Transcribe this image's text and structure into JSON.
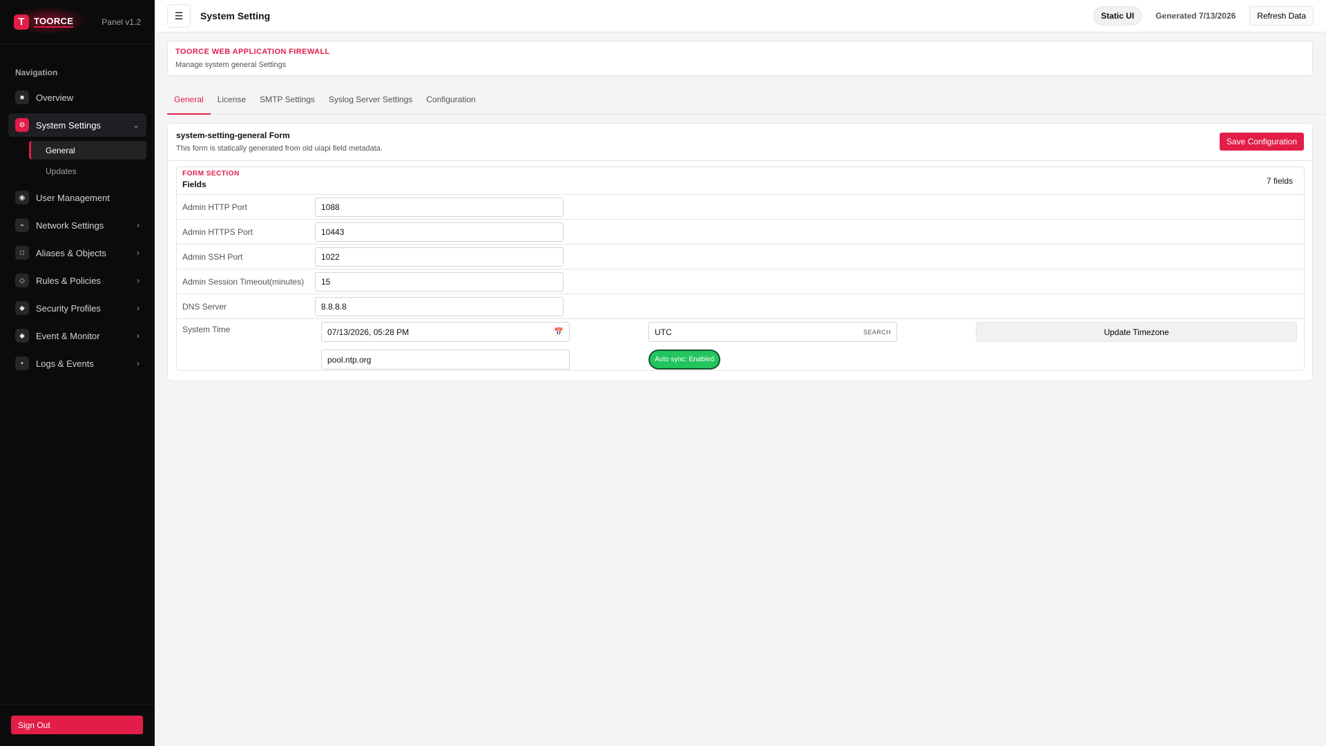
{
  "brand": {
    "logo_letter": "T",
    "name": "TOORCE",
    "version": "Panel v1.2"
  },
  "sidebar": {
    "nav_title": "Navigation",
    "items": [
      {
        "label": "Overview",
        "icon": "grid-icon",
        "glyph": "■"
      },
      {
        "label": "System Settings",
        "icon": "gear-icon",
        "glyph": "⚙",
        "chevron": "⌄"
      },
      {
        "label": "User Management",
        "icon": "user-icon",
        "glyph": "◉"
      },
      {
        "label": "Network Settings",
        "icon": "network-icon",
        "glyph": "⌁",
        "chevron": "›"
      },
      {
        "label": "Aliases & Objects",
        "icon": "box-icon",
        "glyph": "□",
        "chevron": "›"
      },
      {
        "label": "Rules & Policies",
        "icon": "diamond-icon",
        "glyph": "◇",
        "chevron": "›"
      },
      {
        "label": "Security Profiles",
        "icon": "shield-icon",
        "glyph": "◆",
        "chevron": "›"
      },
      {
        "label": "Event & Monitor",
        "icon": "monitor-icon",
        "glyph": "◆",
        "chevron": "›"
      },
      {
        "label": "Logs & Events",
        "icon": "log-icon",
        "glyph": "•",
        "chevron": "›"
      }
    ],
    "sub_items": [
      {
        "label": "General"
      },
      {
        "label": "Updates"
      }
    ],
    "sign_out": "Sign Out"
  },
  "topbar": {
    "menu_glyph": "☰",
    "title": "System Setting",
    "static_label": "Static UI",
    "generated": "Generated 7/13/2026",
    "refresh": "Refresh Data"
  },
  "header": {
    "kicker": "TOORCE WEB APPLICATION FIREWALL",
    "subtitle": "Manage system general Settings"
  },
  "tabs": [
    {
      "label": "General"
    },
    {
      "label": "License"
    },
    {
      "label": "SMTP Settings"
    },
    {
      "label": "Syslog Server Settings"
    },
    {
      "label": "Configuration"
    }
  ],
  "form": {
    "title": "system-setting-general Form",
    "description": "This form is statically generated from old uiapi field metadata.",
    "save_label": "Save Configuration",
    "section_kicker": "FORM SECTION",
    "section_title": "Fields",
    "field_count": "7 fields",
    "fields": [
      {
        "label": "Admin HTTP Port",
        "value": "1088"
      },
      {
        "label": "Admin HTTPS Port",
        "value": "10443"
      },
      {
        "label": "Admin SSH Port",
        "value": "1022"
      },
      {
        "label": "Admin Session Timeout(minutes)",
        "value": "15"
      },
      {
        "label": "DNS Server",
        "value": "8.8.8.8"
      }
    ],
    "system_time": {
      "label": "System Time",
      "datetime": "07/13/2026, 05:28 PM",
      "timezone": "UTC",
      "search_label": "SEARCH",
      "update_label": "Update Timezone",
      "ntp_server": "pool.ntp.org",
      "autosync": "Auto sync: Enabled"
    }
  },
  "colors": {
    "accent": "#e11d48",
    "success": "#22c55e",
    "sidebar_bg": "#0b0b0c"
  }
}
